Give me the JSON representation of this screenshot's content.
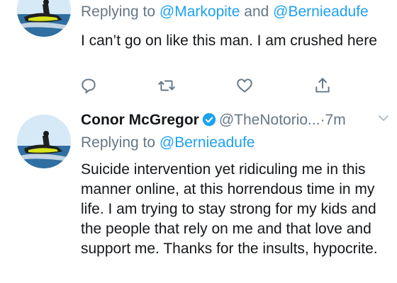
{
  "tweets": [
    {
      "name": "",
      "replying_prefix": "Replying to ",
      "replying_to": [
        "@Markopite",
        "@Bernieadufe"
      ],
      "replying_joiner": " and ",
      "text": "I can’t go on like this man. I am crushed here",
      "actions": [
        "reply-icon",
        "retweet-icon",
        "like-icon",
        "share-icon"
      ]
    },
    {
      "name": "Conor McGregor",
      "verified": true,
      "handle": "@TheNotorio...",
      "time": "·7m",
      "replying_prefix": "Replying to ",
      "replying_to": [
        "@Bernieadufe"
      ],
      "text": "Suicide intervention yet ridiculing me in this manner online, at this horrendous time in my life. I am trying to stay strong for my kids and the people that rely on me and that love and support me. Thanks for the insults, hypocrite."
    }
  ],
  "colors": {
    "link": "#1da1f2",
    "secondary": "#657786",
    "text": "#14171a",
    "divider": "#e1e8ed"
  }
}
